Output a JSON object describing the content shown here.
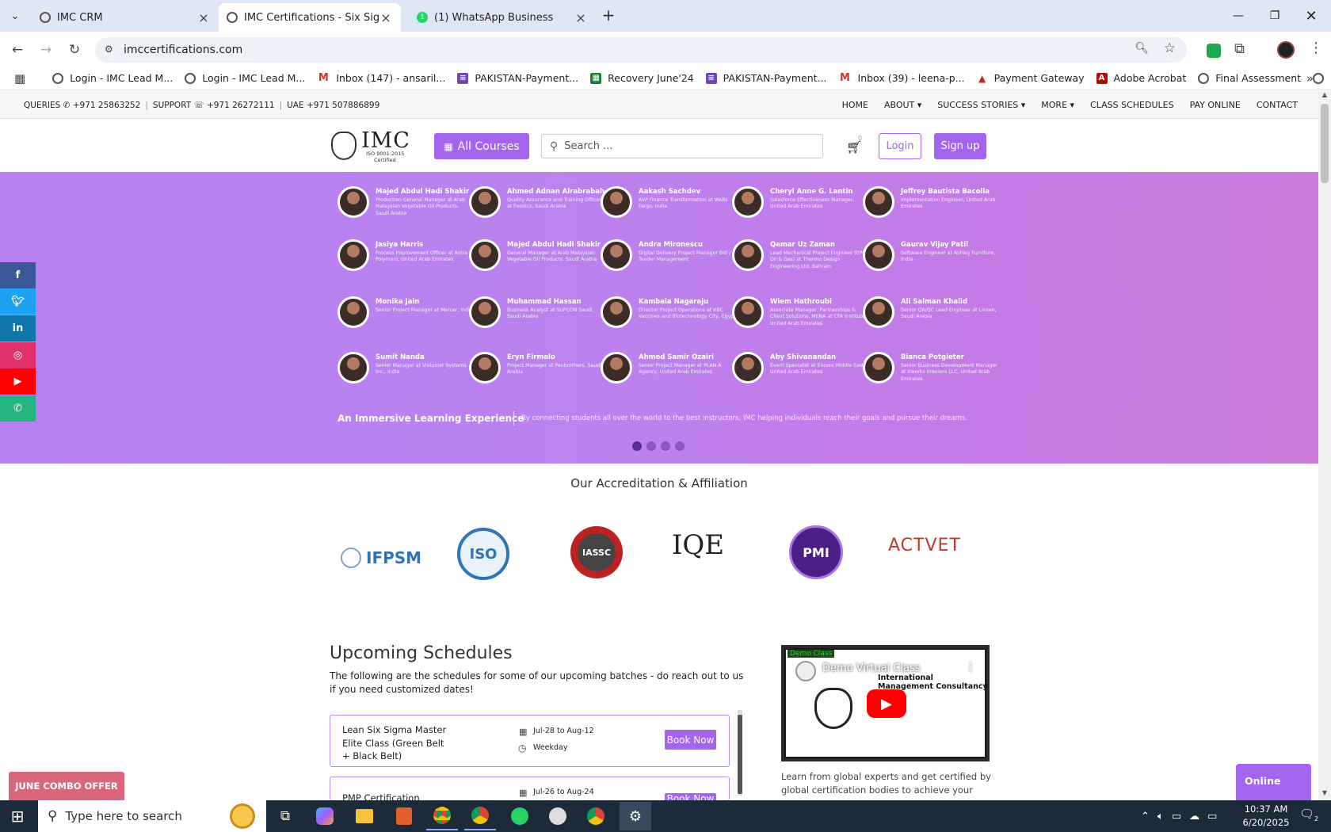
{
  "browser": {
    "tabs": [
      {
        "title": "IMC CRM"
      },
      {
        "title": "IMC Certifications - Six Sigma G"
      },
      {
        "title": "(1) WhatsApp Business",
        "badge": "1"
      }
    ],
    "url": "imccertifications.com",
    "bookmarks": [
      {
        "label": "Login - IMC Lead M...",
        "icon": "imc-icon"
      },
      {
        "label": "Login - IMC Lead M...",
        "icon": "imc-icon"
      },
      {
        "label": "Inbox (147) - ansaril...",
        "icon": "gmail-icon"
      },
      {
        "label": "PAKISTAN-Payment...",
        "icon": "forms-icon"
      },
      {
        "label": "Recovery June'24",
        "icon": "sheets-icon"
      },
      {
        "label": "PAKISTAN-Payment...",
        "icon": "forms-icon"
      },
      {
        "label": "Inbox (39) - leena-p...",
        "icon": "gmail-icon"
      },
      {
        "label": "Payment Gateway",
        "icon": "gateway-icon"
      },
      {
        "label": "Adobe Acrobat",
        "icon": "acrobat-icon"
      },
      {
        "label": "Final Assessment",
        "icon": "imc-icon"
      }
    ]
  },
  "site": {
    "topbar": {
      "queries": "QUERIES ✆ +971 25863252",
      "support": "SUPPORT ☏ +971 26272111",
      "uae": "UAE +971 507886899",
      "menu": [
        "HOME",
        "ABOUT ▾",
        "SUCCESS STORIES ▾",
        "MORE ▾",
        "CLASS SCHEDULES",
        "PAY ONLINE",
        "CONTACT"
      ]
    },
    "header": {
      "logo_text": "IMC",
      "logo_sub1": "ISO 9001:2015",
      "logo_sub2": "Certified",
      "all_courses": "All Courses",
      "search_placeholder": "Search ...",
      "cart_count": "0",
      "login": "Login",
      "signup": "Sign up"
    },
    "hero": {
      "people": [
        {
          "name": "Majed Abdul Hadi Shakir",
          "role": "Production General Manager at Arab Malaysian Vegetable Oil Products, Saudi Arabia"
        },
        {
          "name": "Ahmed Adnan Alrabrabah",
          "role": "Quality Assurance and Training Officer at Foodics, Saudi Arabia"
        },
        {
          "name": "Aakash Sachdev",
          "role": "AVP Finance Transformation at Wells Fargo, India"
        },
        {
          "name": "Cheryl Anne G. Lantin",
          "role": "Salesforce Effectiveness Manager, United Arab Emirates"
        },
        {
          "name": "Jeffrey Bautista Bacolla",
          "role": "Implementation Engineer, United Arab Emirates"
        },
        {
          "name": "Jasiya Harris",
          "role": "Process Improvement Officer at Astra Polymers, United Arab Emirates"
        },
        {
          "name": "Majed Abdul Hadi Shakir",
          "role": "General Manager at Arab Malaysian Vegetable Oil Products, Saudi Arabia"
        },
        {
          "name": "Andra Mironescu",
          "role": "Digital Delivery Project Manager Bid / Tender Management"
        },
        {
          "name": "Qamar Uz Zaman",
          "role": "Lead Mechanical Project Engineer (EPC Oil & Gas) at Thermo Design Engineering Ltd, Bahrain"
        },
        {
          "name": "Gaurav Vijay Patil",
          "role": "Software Engineer at Ashley Furniture, India"
        },
        {
          "name": "Monika Jain",
          "role": "Senior Project Manager at Mercer, India"
        },
        {
          "name": "Muhammad Hassan",
          "role": "Business Analyst at SUPCON Saudi, Saudi Arabia"
        },
        {
          "name": "Kambala Nagaraju",
          "role": "Director Project Operations at VBC Vaccines and Biotechnology City, Egypt"
        },
        {
          "name": "Wiem Hathroubi",
          "role": "Associate Manager, Partnerships & Client Solutions, MENA at CFA Institute, United Arab Emirates"
        },
        {
          "name": "Ali Salman Khalid",
          "role": "Senior QA/QC Lead Engineer at Linsen, Saudi Arabia"
        },
        {
          "name": "Sumit Nanda",
          "role": "Senior Manager at Vialumet Systems Inc., India"
        },
        {
          "name": "Eryn Firmalo",
          "role": "Project Manager at Penbrothers, Saudi Arabia"
        },
        {
          "name": "Ahmed Samir Ozairi",
          "role": "Senior Project Manager at PLAN A Agency, United Arab Emirates"
        },
        {
          "name": "Aby Shivanandan",
          "role": "Event Specialist at Encore Middle East, United Arab Emirates"
        },
        {
          "name": "Bianca Potgieter",
          "role": "Senior Business Development Manager at Xworks Interiors LLC, United Arab Emirates"
        }
      ],
      "tagline": "An Immersive Learning Experience",
      "description": "By connecting students all over the world to the best instructors, IMC helping individuals reach their goals and pursue their dreams."
    },
    "accreditation": {
      "title": "Our Accreditation & Affiliation",
      "logos": [
        "IFPSM",
        "ISO",
        "IASSC",
        "IQE",
        "PMI",
        "ACTVET"
      ]
    },
    "schedules": {
      "title": "Upcoming Schedules",
      "intro": "The following are the schedules for some of our upcoming batches - do reach out to us if you need customized dates!",
      "items": [
        {
          "course": "Lean Six Sigma Master Elite Class (Green Belt + Black Belt)",
          "dates": "Jul-28 to Aug-12",
          "mode": "Weekday",
          "button": "Book Now"
        },
        {
          "course": "PMP Certification",
          "dates": "Jul-26 to Aug-24",
          "mode": "",
          "button": "Book Now"
        }
      ]
    },
    "video": {
      "label": "Demo Class",
      "title": "Demo Virtual Class",
      "thumb_title": "International Management Consultancy",
      "caption": "Learn from global experts and get certified by global certification bodies to achieve your career"
    },
    "promo": "JUNE COMBO OFFER",
    "chat": "Online",
    "social": [
      "facebook",
      "twitter",
      "linkedin",
      "instagram",
      "youtube",
      "whatsapp"
    ]
  },
  "taskbar": {
    "search_placeholder": "Type here to search",
    "time": "10:37 AM",
    "date": "6/20/2025",
    "notification_count": "2"
  }
}
